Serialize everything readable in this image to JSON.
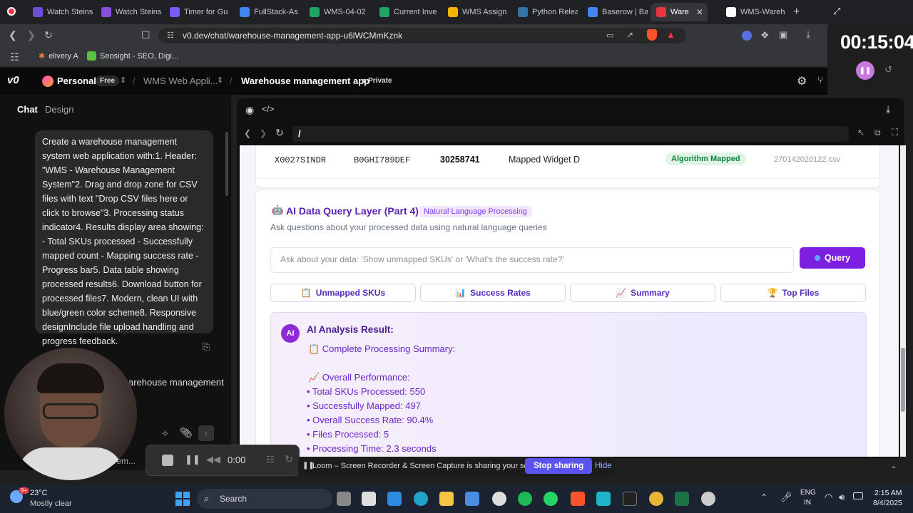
{
  "browser": {
    "tabs": [
      {
        "label": "Watch Steins",
        "color": "#6b4fd8"
      },
      {
        "label": "Watch Steins",
        "color": "#8a4fd8"
      },
      {
        "label": "Timer for Gu",
        "color": "#7a5af8"
      },
      {
        "label": "FullStack-As",
        "color": "#4285f4"
      },
      {
        "label": "WMS-04-02",
        "color": "#1fa463"
      },
      {
        "label": "Current Inve",
        "color": "#1fa463"
      },
      {
        "label": "WMS Assign",
        "color": "#f4b400"
      },
      {
        "label": "Python Relea",
        "color": "#3572a5"
      },
      {
        "label": "Baserow | Ba",
        "color": "#4285f4"
      },
      {
        "label": "Ware",
        "color": "#e34"
      },
      {
        "label": "WMS-Wareh",
        "color": "#fff"
      }
    ],
    "url": "v0.dev/chat/warehouse-management-app-u6lWCMmKznk",
    "bookmarks": [
      {
        "label": "elivery A"
      },
      {
        "label": "Seosight - SEO, Digi..."
      }
    ]
  },
  "timer": {
    "value": "00:15:04"
  },
  "v0": {
    "logo": "v0",
    "workspace": "Personal",
    "plan": "Free",
    "project": "WMS Web Appli...",
    "chat_title": "Warehouse management app",
    "visibility": "Private",
    "tabs": [
      "Chat",
      "Design"
    ]
  },
  "chat": {
    "message": "Create a warehouse management system web application with:1. Header: \"WMS - Warehouse Management System\"2. Drag and drop zone for CSV files with text \"Drop CSV files here or click to browse\"3. Processing status indicator4. Results display area showing: - Total SKUs processed - Successfully mapped count - Mapping success rate - Progress bar5. Data table showing processed results6. Download button for processed files7. Modern, clean UI with blue/green color scheme8. Responsive designInclude file upload handling and progress feedback.",
    "next_snippet": "arehouse management",
    "partial_input": "s rem..."
  },
  "preview": {
    "path": "/",
    "table_row": {
      "sku": "X0027SINDR",
      "asin": "B0GHI789DEF",
      "msku": "30258741",
      "product": "Mapped Widget D",
      "status": "Algorithm Mapped",
      "file": "270142020122.csv"
    },
    "ai_layer": {
      "title": "AI Data Query Layer (Part 4)",
      "badge": "Natural Language Processing",
      "subtitle": "Ask questions about your processed data using natural language queries",
      "placeholder": "Ask about your data: 'Show unmapped SKUs' or 'What's the success rate?'",
      "query_button": "Query",
      "chips": [
        {
          "icon": "📋",
          "label": "Unmapped SKUs"
        },
        {
          "icon": "📊",
          "label": "Success Rates"
        },
        {
          "icon": "📈",
          "label": "Summary"
        },
        {
          "icon": "🏆",
          "label": "Top Files"
        }
      ],
      "result": {
        "badge": "AI",
        "heading": "AI Analysis Result:",
        "lines": [
          "📋 Complete Processing Summary:",
          "",
          "📈 Overall Performance:",
          "• Total SKUs Processed: 550",
          "• Successfully Mapped: 497",
          "• Overall Success Rate: 90.4%",
          "• Files Processed: 5",
          "• Processing Time: 2.3 seconds"
        ]
      }
    }
  },
  "loom": {
    "time": "0:00",
    "banner": "Loom – Screen Recorder & Screen Capture is sharing your screen.",
    "stop_label": "Stop sharing",
    "hide_label": "Hide"
  },
  "taskbar": {
    "weather_temp": "23°C",
    "weather_desc": "Mostly clear",
    "search": "Search",
    "lang": "ENG",
    "region": "IN",
    "time": "2:15 AM",
    "date": "8/4/2025",
    "weather_badge": "9+"
  }
}
